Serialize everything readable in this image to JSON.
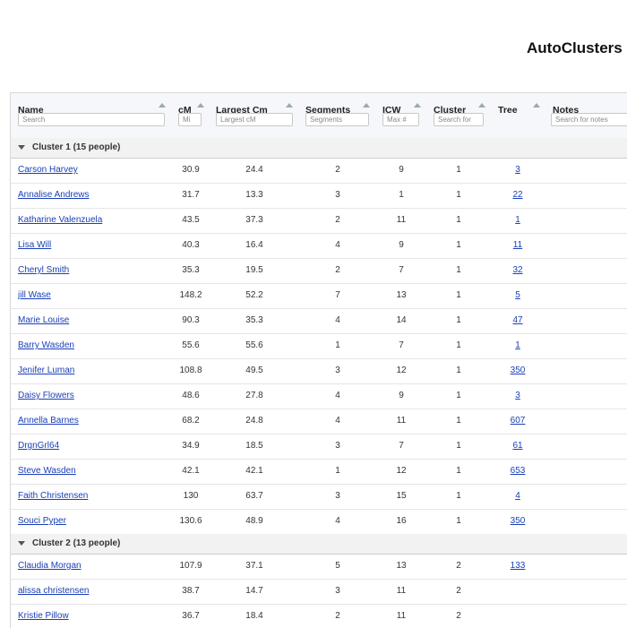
{
  "page": {
    "title": "AutoClusters"
  },
  "columns": [
    {
      "key": "name",
      "label": "Name",
      "placeholder": "Search"
    },
    {
      "key": "cm",
      "label": "cM",
      "placeholder": "Mi"
    },
    {
      "key": "largest",
      "label": "Largest Cm",
      "placeholder": "Largest cM"
    },
    {
      "key": "segments",
      "label": "Segments",
      "placeholder": "Segments"
    },
    {
      "key": "icw",
      "label": "ICW",
      "placeholder": "Max #"
    },
    {
      "key": "cluster",
      "label": "Cluster",
      "placeholder": "Search for"
    },
    {
      "key": "tree",
      "label": "Tree",
      "placeholder": ""
    },
    {
      "key": "notes",
      "label": "Notes",
      "placeholder": "Search for notes"
    }
  ],
  "groups": [
    {
      "label": "Cluster 1   (15 people)",
      "rows": [
        {
          "name": "Carson Harvey",
          "cm": "30.9",
          "largest": "24.4",
          "segments": "2",
          "icw": "9",
          "cluster": "1",
          "tree": "3"
        },
        {
          "name": "Annalise Andrews",
          "cm": "31.7",
          "largest": "13.3",
          "segments": "3",
          "icw": "1",
          "cluster": "1",
          "tree": "22"
        },
        {
          "name": "Katharine Valenzuela",
          "cm": "43.5",
          "largest": "37.3",
          "segments": "2",
          "icw": "11",
          "cluster": "1",
          "tree": "1"
        },
        {
          "name": "Lisa Will",
          "cm": "40.3",
          "largest": "16.4",
          "segments": "4",
          "icw": "9",
          "cluster": "1",
          "tree": "11"
        },
        {
          "name": "Cheryl Smith",
          "cm": "35.3",
          "largest": "19.5",
          "segments": "2",
          "icw": "7",
          "cluster": "1",
          "tree": "32"
        },
        {
          "name": "jill Wase",
          "cm": "148.2",
          "largest": "52.2",
          "segments": "7",
          "icw": "13",
          "cluster": "1",
          "tree": "5"
        },
        {
          "name": "Marie Louise",
          "cm": "90.3",
          "largest": "35.3",
          "segments": "4",
          "icw": "14",
          "cluster": "1",
          "tree": "47"
        },
        {
          "name": "Barry Wasden",
          "cm": "55.6",
          "largest": "55.6",
          "segments": "1",
          "icw": "7",
          "cluster": "1",
          "tree": "1"
        },
        {
          "name": "Jenifer Luman",
          "cm": "108.8",
          "largest": "49.5",
          "segments": "3",
          "icw": "12",
          "cluster": "1",
          "tree": "350"
        },
        {
          "name": "Daisy Flowers",
          "cm": "48.6",
          "largest": "27.8",
          "segments": "4",
          "icw": "9",
          "cluster": "1",
          "tree": "3"
        },
        {
          "name": "Annella Barnes",
          "cm": "68.2",
          "largest": "24.8",
          "segments": "4",
          "icw": "11",
          "cluster": "1",
          "tree": "607"
        },
        {
          "name": "DrgnGrl64",
          "cm": "34.9",
          "largest": "18.5",
          "segments": "3",
          "icw": "7",
          "cluster": "1",
          "tree": "61"
        },
        {
          "name": "Steve Wasden",
          "cm": "42.1",
          "largest": "42.1",
          "segments": "1",
          "icw": "12",
          "cluster": "1",
          "tree": "653"
        },
        {
          "name": "Faith Christensen",
          "cm": "130",
          "largest": "63.7",
          "segments": "3",
          "icw": "15",
          "cluster": "1",
          "tree": "4"
        },
        {
          "name": "Souci Pyper",
          "cm": "130.6",
          "largest": "48.9",
          "segments": "4",
          "icw": "16",
          "cluster": "1",
          "tree": "350"
        }
      ]
    },
    {
      "label": "Cluster 2   (13 people)",
      "rows": [
        {
          "name": "Claudia Morgan",
          "cm": "107.9",
          "largest": "37.1",
          "segments": "5",
          "icw": "13",
          "cluster": "2",
          "tree": "133"
        },
        {
          "name": "alissa christensen",
          "cm": "38.7",
          "largest": "14.7",
          "segments": "3",
          "icw": "11",
          "cluster": "2",
          "tree": ""
        },
        {
          "name": "Kristie Pillow",
          "cm": "36.7",
          "largest": "18.4",
          "segments": "2",
          "icw": "11",
          "cluster": "2",
          "tree": ""
        }
      ]
    }
  ]
}
